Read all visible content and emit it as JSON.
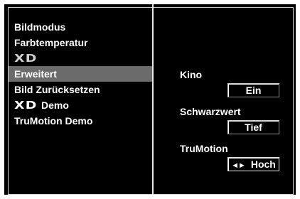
{
  "menu": {
    "items": [
      {
        "label": "Bildmodus",
        "selected": false
      },
      {
        "label": "Farbtemperatur",
        "selected": false
      },
      {
        "label": "",
        "logo": "XD",
        "selected": false
      },
      {
        "label": "Erweitert",
        "selected": true
      },
      {
        "label": "Bild Zurücksetzen",
        "selected": false
      },
      {
        "label": "Demo",
        "logo": "XD",
        "selected": false
      },
      {
        "label": "TruMotion Demo",
        "selected": false
      }
    ]
  },
  "settings": {
    "kino": {
      "label": "Kino",
      "value": "Ein"
    },
    "schwarzwert": {
      "label": "Schwarzwert",
      "value": "Tief"
    },
    "trumotion": {
      "label": "TruMotion",
      "value": "Hoch",
      "arrows": "◄►"
    }
  },
  "colors": {
    "background": "#000000",
    "selected_row": "#6b6b6b",
    "text": "#ffffff"
  }
}
